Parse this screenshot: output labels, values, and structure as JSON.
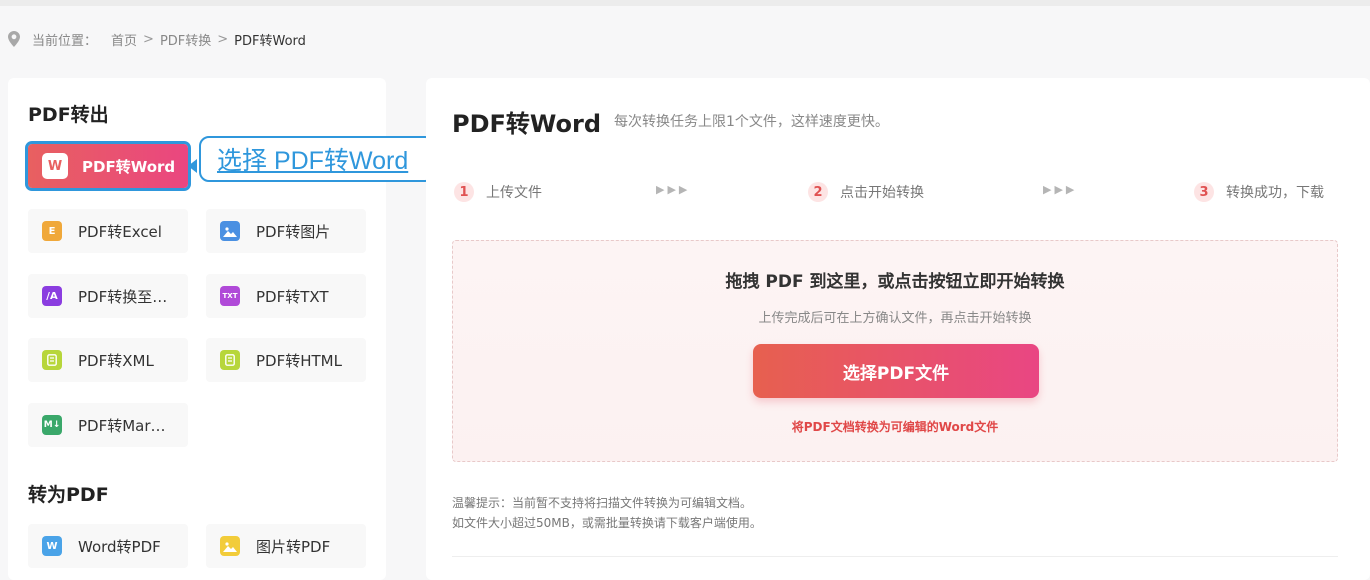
{
  "breadcrumb": {
    "label": "当前位置：",
    "items": [
      "首页",
      "PDF转换",
      "PDF转Word"
    ],
    "separator": ">"
  },
  "sidebar": {
    "section_export": "PDF转出",
    "export_tools": [
      {
        "label": "PDF转Word",
        "icon": "W",
        "color": "#e86060",
        "active": true
      },
      {
        "label": "PDF转Excel",
        "icon": "E",
        "color": "#f0a83a"
      },
      {
        "label": "PDF转图片",
        "icon": "image-icon",
        "color": "#4a90e2"
      },
      {
        "label": "PDF转换至…",
        "icon": "/A",
        "color": "#8b3de0"
      },
      {
        "label": "PDF转TXT",
        "icon": "TXT",
        "color": "#b04ad8"
      },
      {
        "label": "PDF转XML",
        "icon": "doc-icon",
        "color": "#b7d63a"
      },
      {
        "label": "PDF转HTML",
        "icon": "doc-icon",
        "color": "#b7d63a"
      },
      {
        "label": "PDF转Mar…",
        "icon": "M↓",
        "color": "#3aa86a"
      }
    ],
    "section_import": "转为PDF",
    "import_tools": [
      {
        "label": "Word转PDF",
        "icon": "W",
        "color": "#4aa3e8"
      },
      {
        "label": "图片转PDF",
        "icon": "image-icon",
        "color": "#f2cc3a"
      }
    ]
  },
  "callout": {
    "text": "选择 PDF转Word",
    "color": "#2f97dc"
  },
  "main": {
    "title": "PDF转Word",
    "subtitle": "每次转换任务上限1个文件，这样速度更快。",
    "steps": [
      {
        "num": "1",
        "label": "上传文件"
      },
      {
        "num": "2",
        "label": "点击开始转换"
      },
      {
        "num": "3",
        "label": "转换成功，下载"
      }
    ],
    "step_arrows": "▶▶▶",
    "dropzone": {
      "title": "拖拽 PDF 到这里，或点击按钮立即开始转换",
      "hint": "上传完成后可在上方确认文件，再点击开始转换",
      "button": "选择PDF文件",
      "note": "将PDF文档转换为可编辑的Word文件"
    },
    "tips": [
      "温馨提示：当前暂不支持将扫描文件转换为可编辑文档。",
      "如文件大小超过50MB，或需批量转换请下载客户端使用。"
    ]
  }
}
